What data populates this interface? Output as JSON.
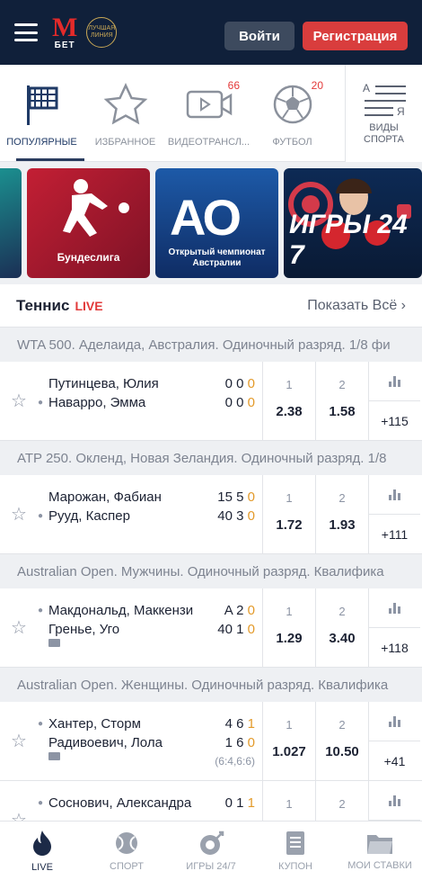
{
  "header": {
    "logo_m": "M",
    "logo_bet": "БЕТ",
    "award": "ЛУЧШАЯ ЛИНИЯ",
    "login": "Войти",
    "register": "Регистрация"
  },
  "tabs": [
    {
      "label": "ПОПУЛЯРНЫЕ",
      "icon": "flag-icon",
      "badge": ""
    },
    {
      "label": "ИЗБРАННОЕ",
      "icon": "star-icon",
      "badge": ""
    },
    {
      "label": "ВИДЕОТРАНСЛ...",
      "icon": "video-icon",
      "badge": "66"
    },
    {
      "label": "ФУТБОЛ",
      "icon": "football-icon",
      "badge": "20"
    }
  ],
  "sports_all": {
    "label_line1": "ВИДЫ",
    "label_line2": "СПОРТА"
  },
  "banners": [
    {
      "caption": "Бундеслига"
    },
    {
      "logo": "AO",
      "caption_line1": "Открытый чемпионат",
      "caption_line2": "Австралии"
    },
    {
      "caption": "ИГРЫ 24 7"
    }
  ],
  "section": {
    "title": "Теннис",
    "live": "LIVE",
    "show_all": "Показать Всё"
  },
  "matches": [
    {
      "league": "WTA 500. Аделаида, Австралия. Одиночный разряд. 1/8 фи",
      "p1": "Путинцева, Юлия",
      "p2": "Наварро, Эмма",
      "s1": "0 0 ",
      "s1o": "0",
      "s2": "0 0 ",
      "s2o": "0",
      "sub": "",
      "odd1": "2.38",
      "odd2": "1.58",
      "more": "+115",
      "serve": 2,
      "video": false
    },
    {
      "league": "ATP 250. Окленд, Новая Зеландия. Одиночный разряд. 1/8",
      "p1": "Марожан, Фабиан",
      "p2": "Рууд, Каспер",
      "s1": "15 5 ",
      "s1o": "0",
      "s2": "40 3 ",
      "s2o": "0",
      "sub": "",
      "odd1": "1.72",
      "odd2": "1.93",
      "more": "+111",
      "serve": 2,
      "video": false
    },
    {
      "league": "Australian Open. Мужчины. Одиночный разряд. Квалифика",
      "p1": "Макдональд, Маккензи",
      "p2": "Гренье, Уго",
      "s1": "A 2 ",
      "s1o": "0",
      "s2": "40 1 ",
      "s2o": "0",
      "sub": "",
      "odd1": "1.29",
      "odd2": "3.40",
      "more": "+118",
      "serve": 1,
      "video": true
    },
    {
      "league": "Australian Open. Женщины. Одиночный разряд. Квалифика",
      "p1": "Хантер, Сторм",
      "p2": "Радивоевич, Лола",
      "s1": "4 6 ",
      "s1o": "1",
      "s2": "1 6 ",
      "s2o": "0",
      "sub": "(6:4,6:6)",
      "odd1": "1.027",
      "odd2": "10.50",
      "more": "+41",
      "serve": 1,
      "video": true
    },
    {
      "league": "",
      "p1": "Соснович, Александра",
      "p2": "",
      "s1": "0 1 ",
      "s1o": "1",
      "s2": "",
      "s2o": "",
      "sub": "",
      "odd1": "",
      "odd2": "",
      "more": "",
      "serve": 1,
      "video": false
    }
  ],
  "odd_labels": {
    "one": "1",
    "two": "2"
  },
  "bottom_nav": [
    {
      "label": "LIVE",
      "icon": "flame-icon"
    },
    {
      "label": "СПОРТ",
      "icon": "ball-icon"
    },
    {
      "label": "ИГРЫ 24/7",
      "icon": "games-icon"
    },
    {
      "label": "КУПОН",
      "icon": "coupon-icon"
    },
    {
      "label": "МОИ СТАВКИ",
      "icon": "folder-icon"
    }
  ]
}
